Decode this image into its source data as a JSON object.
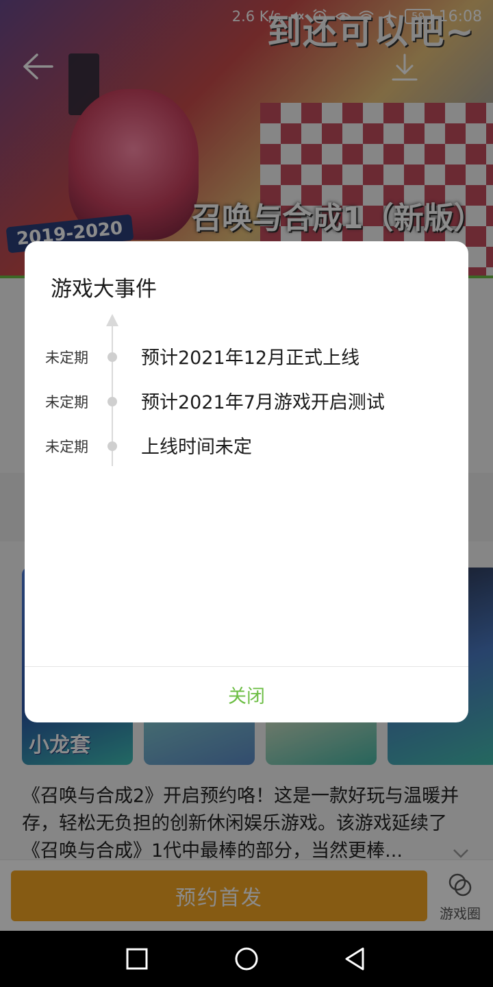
{
  "status_bar": {
    "network_speed": "2.6 K/s",
    "time": "16:08",
    "battery": "59",
    "icons": [
      "mute-icon",
      "alarm-icon",
      "eye-comfort-icon",
      "wifi-icon",
      "airplane-icon"
    ]
  },
  "hero": {
    "slogan": "到还可以吧~",
    "game_title_art": "召唤与合成1（新版）",
    "year_badge": "2019-2020"
  },
  "screenshots": {
    "first_caption": "小龙套"
  },
  "description": {
    "text": "《召唤与合成2》开启预约咯！这是一款好玩与温暖并存，轻松无负担的创新休闲娱乐游戏。该游戏延续了《召唤与合成》1代中最棒的部分，当然更棒..."
  },
  "bottom_bar": {
    "reserve_label": "预约首发",
    "circle_label": "游戏圈"
  },
  "dialog": {
    "title": "游戏大事件",
    "events": [
      {
        "date": "未定期",
        "text": "预计2021年12月正式上线"
      },
      {
        "date": "未定期",
        "text": "预计2021年7月游戏开启测试"
      },
      {
        "date": "未定期",
        "text": "上线时间未定"
      }
    ],
    "close_label": "关闭"
  },
  "colors": {
    "accent_green": "#6dbe45",
    "reserve_orange": "#f5a623"
  }
}
